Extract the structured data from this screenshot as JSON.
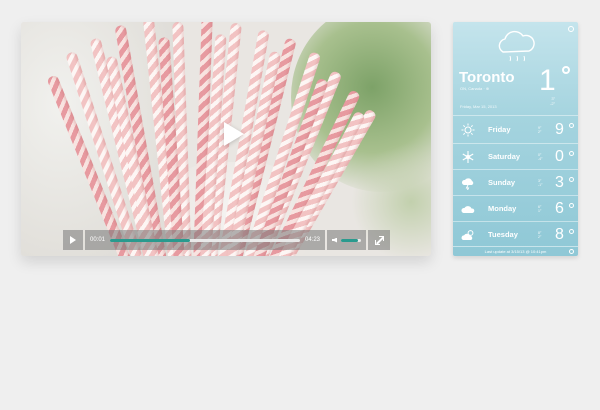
{
  "video": {
    "current_time": "00:01",
    "duration": "04:23",
    "progress": 0.42,
    "volume": 0.85,
    "big_play_icon": "play-icon",
    "colors": {
      "accent": "#2a9a8e"
    }
  },
  "weather": {
    "city": "Toronto",
    "region": "ON, Canada · ⊕",
    "temp": "1",
    "hi": "3°",
    "lo": "-2°",
    "date": "Friday, Mar 15, 2013",
    "days": [
      {
        "name": "Friday",
        "temp": "9",
        "hi": "9°",
        "lo": "2°",
        "icon": "sun-icon"
      },
      {
        "name": "Saturday",
        "temp": "0",
        "hi": "0°",
        "lo": "-4°",
        "icon": "snow-icon"
      },
      {
        "name": "Sunday",
        "temp": "3",
        "hi": "3°",
        "lo": "-1°",
        "icon": "storm-icon"
      },
      {
        "name": "Monday",
        "temp": "6",
        "hi": "6°",
        "lo": "1°",
        "icon": "cloud-icon"
      },
      {
        "name": "Tuesday",
        "temp": "8",
        "hi": "8°",
        "lo": "2°",
        "icon": "partly-cloudy-icon"
      }
    ],
    "last_update": "Last update at 3/15/13 @ 10:41pm",
    "colors": {
      "top": "#c4e4ec",
      "bottom": "#8fc8d6"
    }
  }
}
